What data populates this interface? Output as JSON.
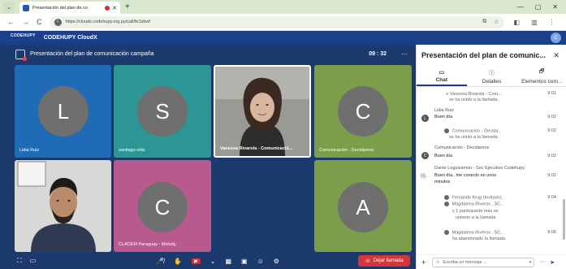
{
  "browser": {
    "tab_title": "Presentación del plan de co",
    "url": "https://cloudx.codehupy.org.py/call/fe1xbwf",
    "menu_glyph": "⌄",
    "tab_close_glyph": "✕",
    "new_tab_glyph": "+",
    "window_controls": {
      "minimize": "—",
      "maximize": "▢",
      "close": "✕"
    },
    "nav": {
      "back": "←",
      "forward": "→",
      "reload": "C"
    },
    "site_info_glyph": "i",
    "omni_icons": {
      "cast": "⧉",
      "bookmark": "☆"
    },
    "toolbar_icons": {
      "extensions": "◧",
      "sidebar": "▥",
      "menu": "⋮"
    }
  },
  "app": {
    "logo_text": "CODEHUPY",
    "logo_sub": "····",
    "title": "CODEHUPY CloudX",
    "user_initial": "C",
    "accent_color": "#1c3f8a"
  },
  "meeting": {
    "title": "Presentación del plan de comunicación campaña",
    "timer": "09 : 32",
    "more_glyph": "···",
    "tiles": [
      {
        "name": "Lidia Ruiz",
        "initial": "L",
        "color": "#1f6bb5",
        "has_video": false
      },
      {
        "name": "santiago ortiz",
        "initial": "S",
        "color": "#2e9595",
        "has_video": false
      },
      {
        "name": "Vanessa Rivarola - Comunicació...",
        "initial": "",
        "color": "#8a8a8a",
        "has_video": true,
        "active": true
      },
      {
        "name": "Comunicación - Decidamos",
        "initial": "C",
        "color": "#7a9e4a",
        "has_video": false
      },
      {
        "name": "",
        "initial": "",
        "color": "#5a5a5a",
        "has_video": true
      },
      {
        "name": "CLADEM Paraguay - Melody",
        "initial": "C",
        "color": "#b95a8e",
        "has_video": false
      },
      {
        "name": "",
        "initial": "A",
        "color": "#7a9e4a",
        "has_video": false
      }
    ],
    "toolbar": {
      "fullscreen_glyph": "⛶",
      "layout_glyph": "▭",
      "mic_glyph": "🎤̸",
      "raise_hand_glyph": "✋",
      "camera_off_glyph": "▶̸",
      "camera_menu_glyph": "⌄",
      "screen_share_glyph": "▦",
      "present_glyph": "▣",
      "reactions_glyph": "☺",
      "settings_glyph": "⚙",
      "leave_label": "Dejar llamada",
      "leave_glyph": "☏"
    }
  },
  "panel": {
    "title": "Presentación del plan de comunic...",
    "close_glyph": "✕",
    "tabs": [
      {
        "label": "Chat",
        "icon_glyph": "▭",
        "selected": true
      },
      {
        "label": "Detalles",
        "icon_glyph": "ⓘ",
        "selected": false
      },
      {
        "label": "Elementos com...",
        "icon_glyph": "🗗",
        "selected": false
      }
    ],
    "messages": {
      "m1_who": "Vanessa Rivarola - Com...",
      "m1_text": "se ha unido a la llamada",
      "m1_time": "9:01",
      "m2_sender": "Lidia Ruiz",
      "m2_text": "Buen día",
      "m2_time": "9:02",
      "m2_initial": "L",
      "m3_who": "Comunicación - Decida...",
      "m3_text": "se ha unido a la llamada",
      "m3_time": "9:02",
      "m4_sender": "Comunicación - Decidamos",
      "m4_text": "Buen día",
      "m4_time": "9:02",
      "m4_initial": "C",
      "m5_sender": "Dante Loguizamon - Sec Ejecutivo Codehupy",
      "m5_text_1": "Buen día.. me conecto en unos",
      "m5_text_2": "minutos",
      "m5_time": "9:02",
      "m5_initial": "DL",
      "m6_who_1": "Fernando Krug (Invitado) ,",
      "m6_who_2": "Magdalena Riveros , SC...",
      "m6_text_1": "y 1 participante más se",
      "m6_text_2": "unieron a la llamada",
      "m6_time": "9:04",
      "m7_who": "Magdalena Riveros , SC...",
      "m7_text": "ha abandonado la llamada",
      "m7_time": "9:06"
    },
    "composer": {
      "plus_glyph": "+",
      "emoji_glyph": "☺",
      "placeholder": "Escriba un mensaje ...",
      "dropdown_glyph": "▾",
      "more_glyph": "···",
      "send_glyph": "➤"
    }
  }
}
